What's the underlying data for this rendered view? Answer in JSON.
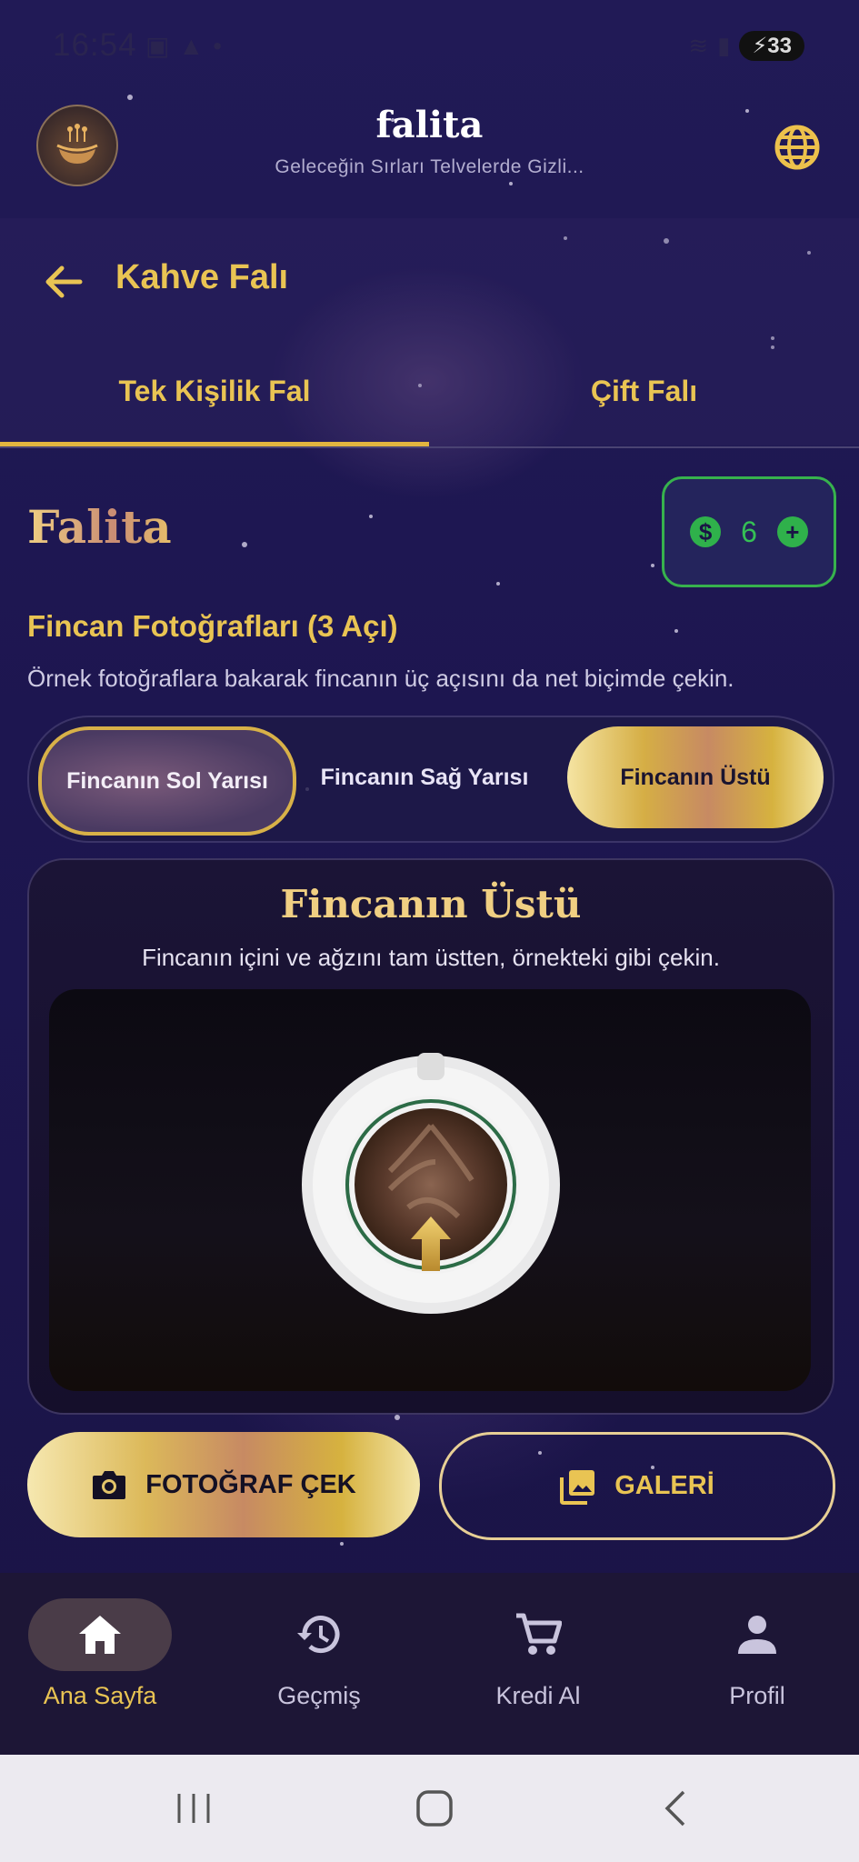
{
  "status_bar": {
    "time": "16:54",
    "battery": "33"
  },
  "app": {
    "title": "falita",
    "subtitle": "Geleceğin Sırları Telvelerde Gizli..."
  },
  "page": {
    "title": "Kahve Falı"
  },
  "tabs": [
    {
      "label": "Tek Kişilik Fal",
      "active": true
    },
    {
      "label": "Çift Falı",
      "active": false
    }
  ],
  "brand_heading": "Falita",
  "credit": {
    "amount": "6",
    "accent": "#35c055"
  },
  "photos_section": {
    "title": "Fincan Fotoğrafları (3 Açı)",
    "description": "Örnek fotoğraflara bakarak fincanın üç açısını da net biçimde çekin."
  },
  "segments": [
    {
      "label": "Fincanın Sol Yarısı"
    },
    {
      "label": "Fincanın Sağ Yarısı"
    },
    {
      "label": "Fincanın Üstü"
    }
  ],
  "card": {
    "title": "Fincanın Üstü",
    "description": "Fincanın içini ve ağzını tam üstten, örnekteki gibi çekin."
  },
  "actions": {
    "camera": "FOTOĞRAF ÇEK",
    "gallery": "GALERİ"
  },
  "bottom_nav": [
    {
      "label": "Ana Sayfa",
      "icon": "home-icon",
      "active": true
    },
    {
      "label": "Geçmiş",
      "icon": "history-icon",
      "active": false
    },
    {
      "label": "Kredi Al",
      "icon": "cart-icon",
      "active": false
    },
    {
      "label": "Profil",
      "icon": "person-icon",
      "active": false
    }
  ],
  "colors": {
    "gold": "#e9c453",
    "background": "#221b5a",
    "green": "#2fb14b"
  }
}
